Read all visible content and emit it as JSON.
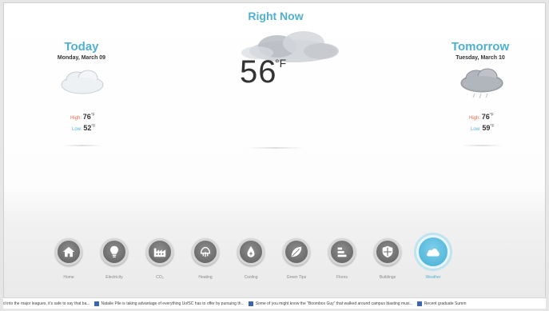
{
  "now": {
    "title": "Right Now",
    "temperature": "56",
    "unit": "°F"
  },
  "today": {
    "title": "Today",
    "date": "Monday, March 09",
    "high_label": "High:",
    "high_value": "76",
    "low_label": "Low:",
    "low_value": "52",
    "unit": "°F"
  },
  "tomorrow": {
    "title": "Tomorrow",
    "date": "Tuesday, March 10",
    "high_label": "High:",
    "high_value": "76",
    "low_label": "Low:",
    "low_value": "59",
    "unit": "°F"
  },
  "nav": [
    {
      "label": "Home",
      "icon": "home-icon"
    },
    {
      "label": "Electricity",
      "icon": "lightbulb-icon"
    },
    {
      "label": "CO₂",
      "icon": "factory-icon"
    },
    {
      "label": "Heating",
      "icon": "heating-icon"
    },
    {
      "label": "Cooling",
      "icon": "water-drop-icon"
    },
    {
      "label": "Green Tips",
      "icon": "leaf-icon"
    },
    {
      "label": "Floors",
      "icon": "floors-icon"
    },
    {
      "label": "Buildings",
      "icon": "shield-icon"
    },
    {
      "label": "Weather",
      "icon": "cloud-icon"
    }
  ],
  "active_nav": "Weather",
  "ticker": [
    "d into the major leagues, it's safe to say that ba...",
    "Natalie Pile is taking advantage of everything UofSC has to offer by pursuing th...",
    "Some of you might know the \"Boombox Guy\" that walked around campus blasting musi...",
    "Recent graduate Summ"
  ],
  "colors": {
    "accent": "#4fb0cf",
    "high": "#e86a4a",
    "low": "#5ab1cf",
    "nav_inactive": "#6e6e6e",
    "ticker_badge": "#3b66b0"
  }
}
